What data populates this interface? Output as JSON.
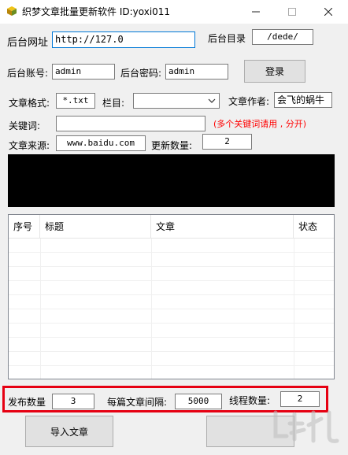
{
  "window": {
    "title": "织梦文章批量更新软件   ID:yoxi011",
    "icon": "app-cube-icon"
  },
  "login": {
    "backend_url_label": "后台网址",
    "backend_url_value": "http://127.0",
    "backend_dir_label": "后台目录",
    "backend_dir_value": "/dede/",
    "account_label": "后台账号:",
    "account_value": "admin",
    "password_label": "后台密码:",
    "password_value": "admin",
    "login_button": "登录"
  },
  "article": {
    "format_label": "文章格式:",
    "format_value": "*.txt",
    "column_label": "栏目:",
    "column_value": "",
    "author_label": "文章作者:",
    "author_value": "会飞的蜗牛",
    "keywords_label": "关键词:",
    "keywords_value": "",
    "keywords_hint": "(多个关键词请用 , 分开)",
    "source_label": "文章来源:",
    "source_value": "www.baidu.com",
    "update_count_label": "更新数量:",
    "update_count_value": "2"
  },
  "table": {
    "columns": [
      "序号",
      "标题",
      "文章",
      "状态"
    ],
    "rows": []
  },
  "settings": {
    "publish_count_label": "发布数量",
    "publish_count_value": "3",
    "interval_label": "每篇文章间隔:",
    "interval_value": "5000",
    "threads_label": "线程数量:",
    "threads_value": "2"
  },
  "footer": {
    "import_button": "导入文章",
    "start_button": ""
  },
  "colors": {
    "highlight_border": "#e60012",
    "hint_text": "#ff0000",
    "console_bg": "#000000"
  }
}
